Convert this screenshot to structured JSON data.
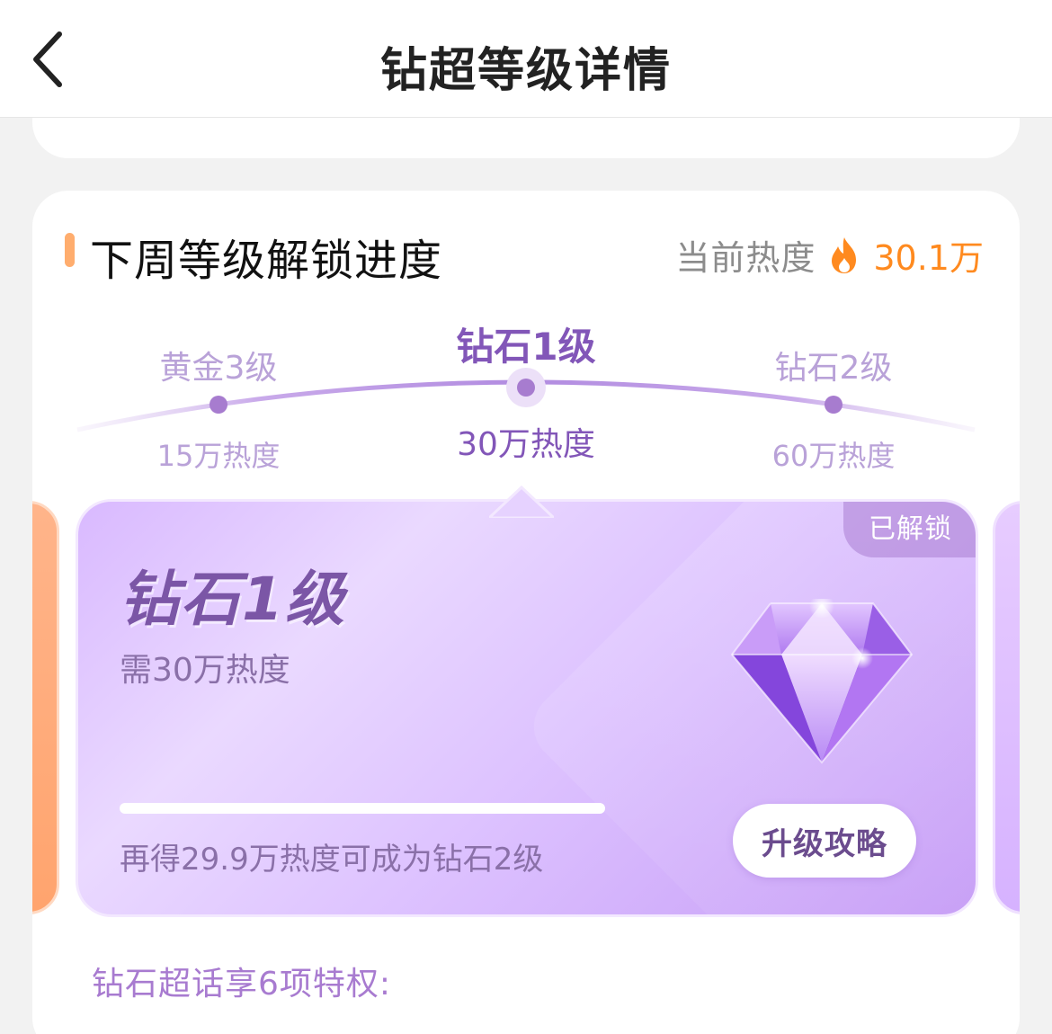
{
  "header": {
    "title": "钻超等级详情"
  },
  "section": {
    "title": "下周等级解锁进度",
    "current_heat_label": "当前热度",
    "current_heat_value": "30.1万"
  },
  "levels": [
    {
      "name": "黄金3级",
      "heat": "15万热度"
    },
    {
      "name": "钻石1级",
      "heat": "30万热度"
    },
    {
      "name": "钻石2级",
      "heat": "60万热度"
    }
  ],
  "current_card": {
    "level_name": "钻石1级",
    "requirement": "需30万热度",
    "status_badge": "已解锁",
    "progress": 0,
    "hint": "再得29.9万热度可成为钻石2级",
    "upgrade_label": "升级攻略"
  },
  "privileges_text": "钻石超话享6项特权:",
  "colors": {
    "accent_purple": "#8256b8",
    "heat_orange": "#ff8a1f"
  }
}
